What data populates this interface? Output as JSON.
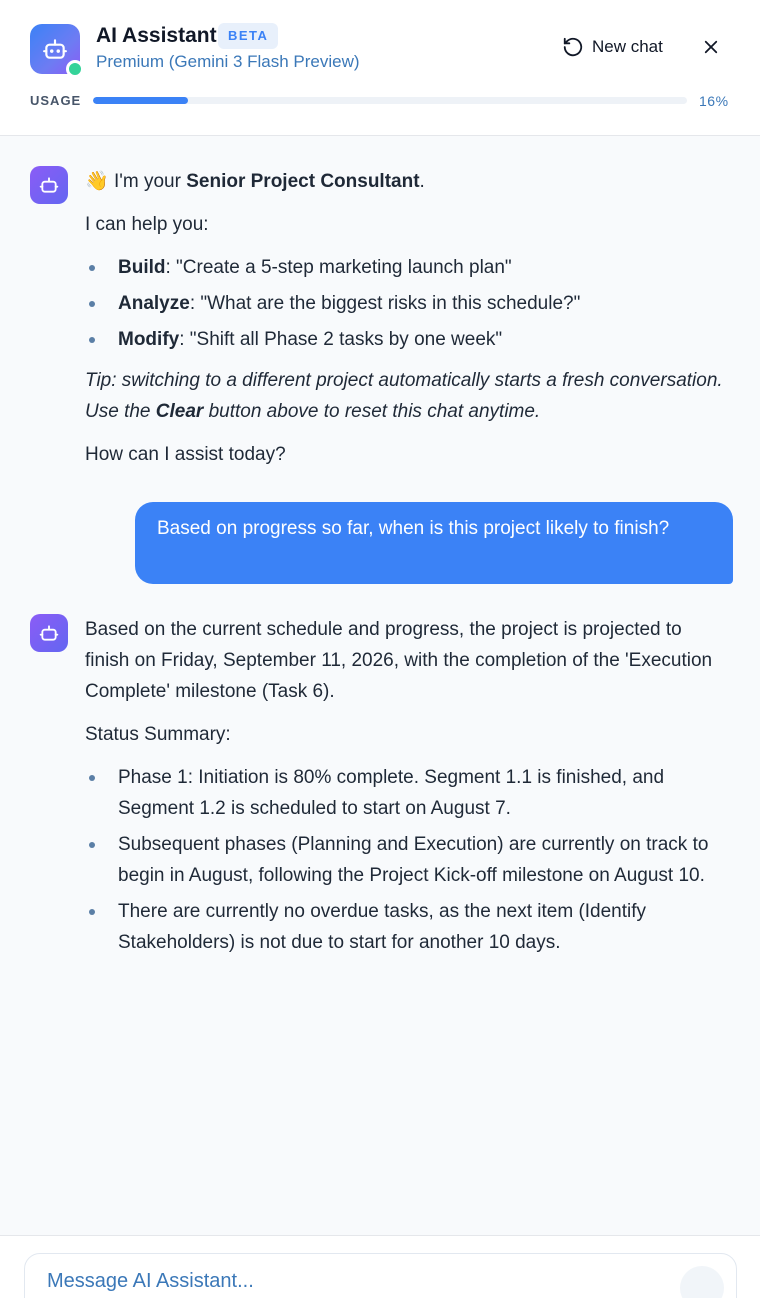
{
  "header": {
    "title": "AI Assistant",
    "badge": "BETA",
    "subtitle": "Premium (Gemini 3 Flash Preview)",
    "new_chat_label": "New chat",
    "usage_label": "USAGE",
    "usage_percent": 16,
    "usage_text": "16%"
  },
  "messages": {
    "welcome": {
      "greeting_emoji": "👋",
      "greeting_prefix": "I'm your ",
      "greeting_bold": "Senior Project Consultant",
      "greeting_suffix": ".",
      "intro": "I can help you:",
      "items": [
        {
          "label": "Build",
          "text": ": \"Create a 5-step marketing launch plan\""
        },
        {
          "label": "Analyze",
          "text": ": \"What are the biggest risks in this schedule?\""
        },
        {
          "label": "Modify",
          "text": ": \"Shift all Phase 2 tasks by one week\""
        }
      ],
      "tip_prefix": "Tip: switching to a different project automatically starts a fresh conversation. Use the ",
      "tip_bold": "Clear",
      "tip_suffix": " button above to reset this chat anytime.",
      "closing": "How can I assist today?"
    },
    "user": {
      "text": "Based on progress so far, when is this project likely to finish?"
    },
    "reply": {
      "intro": "Based on the current schedule and progress, the project is projected to finish on Friday, September 11, 2026, with the completion of the 'Execution Complete' milestone (Task 6).",
      "summary_title": "Status Summary:",
      "items": [
        "Phase 1: Initiation is 80% complete. Segment 1.1 is finished, and Segment 1.2 is scheduled to start on August 7.",
        "Subsequent phases (Planning and Execution) are currently on track to begin in August, following the Project Kick-off milestone on August 10.",
        "There are currently no overdue tasks, as the next item (Identify Stakeholders) is not due to start for another 10 days."
      ]
    }
  },
  "composer": {
    "placeholder": "Message AI Assistant..."
  },
  "colors": {
    "accent": "#3b82f6",
    "status_online": "#34d399",
    "bot_avatar": "#8b5cf6"
  }
}
